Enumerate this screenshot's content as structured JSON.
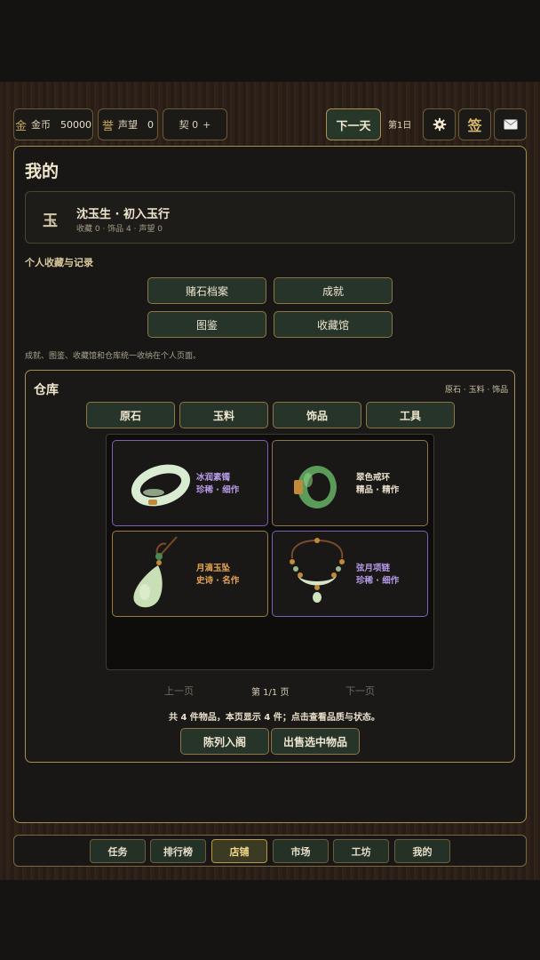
{
  "topbar": {
    "gold": {
      "icon_text": "金",
      "label": "金币",
      "value": "50000"
    },
    "fame": {
      "icon_text": "誉",
      "label": "声望",
      "value": "0"
    },
    "contract": {
      "label": "契 0",
      "add": "+"
    },
    "next_day": "下一天",
    "day": "第1日",
    "settings_icon": "gear-icon",
    "sign_text": "签",
    "mail_icon": "mail-icon"
  },
  "page": {
    "title": "我的",
    "profile": {
      "avatar_text": "玉",
      "name": "沈玉生 · 初入玉行",
      "stats": "收藏 0 · 饰品 4 · 声望 0"
    },
    "section_label": "个人收藏与记录",
    "buttons": [
      "赌石档案",
      "成就",
      "图鉴",
      "收藏馆"
    ],
    "note": "成就、图鉴、收藏馆和仓库统一收纳在个人页面。"
  },
  "warehouse": {
    "title": "仓库",
    "categories_hint": "原石 · 玉料 · 饰品",
    "tabs": [
      "原石",
      "玉料",
      "饰品",
      "工具"
    ],
    "items": [
      {
        "name": "冰润素镯",
        "quality": "珍稀 · 细作",
        "rarity": "purple",
        "icon": "bangle-icon"
      },
      {
        "name": "翠色戒环",
        "quality": "精品 · 精作",
        "rarity": "plain",
        "icon": "ring-icon"
      },
      {
        "name": "月滴玉坠",
        "quality": "史诗 · 名作",
        "rarity": "orange",
        "icon": "pendant-icon"
      },
      {
        "name": "弦月项链",
        "quality": "珍稀 · 细作",
        "rarity": "purple",
        "icon": "necklace-icon"
      }
    ],
    "pager": {
      "prev": "上一页",
      "info": "第 1/1 页",
      "next": "下一页"
    },
    "summary": "共 4 件物品，本页显示 4 件；点击查看品质与状态。",
    "actions": [
      "陈列入阁",
      "出售选中物品"
    ]
  },
  "colors": {
    "accent": "#a88c52",
    "purple": "#b79be8",
    "orange": "#e3a552",
    "button_bg": "#26342a"
  },
  "nav": {
    "items": [
      "任务",
      "排行榜",
      "店铺",
      "市场",
      "工坊",
      "我的"
    ],
    "active": "店铺"
  }
}
